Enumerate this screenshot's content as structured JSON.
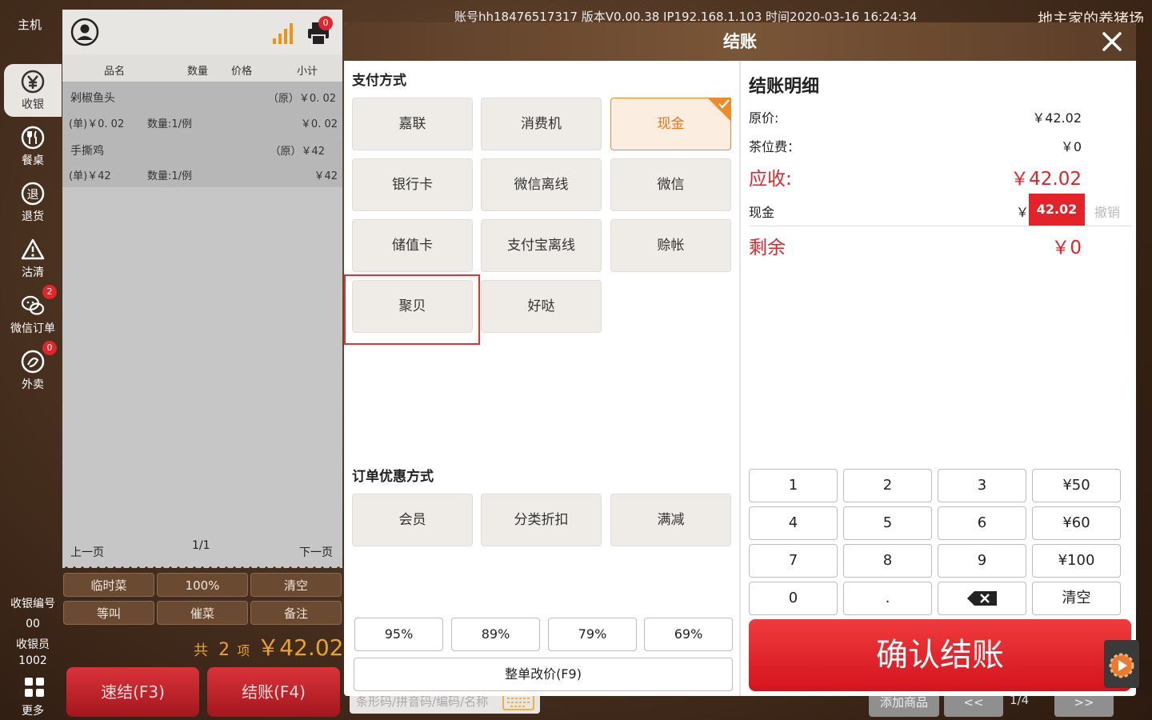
{
  "topbar": {
    "home": "主机",
    "info": "账号hh18476517317  版本V0.00.38  IP192.168.1.103  时间2020-03-16 16:24:34",
    "store": "地主家的养猪场"
  },
  "sidebar": {
    "items": [
      {
        "label": "收银",
        "icon": "yen-icon",
        "active": true
      },
      {
        "label": "餐桌",
        "icon": "cutlery-icon"
      },
      {
        "label": "退货",
        "icon": "return-icon"
      },
      {
        "label": "沽清",
        "icon": "warning-icon"
      },
      {
        "label": "微信订单",
        "icon": "wechat-icon",
        "badge": "2"
      },
      {
        "label": "外卖",
        "icon": "takeout-icon",
        "badge": "0"
      }
    ],
    "cashier_no_label": "收银编号",
    "cashier_no": "00",
    "cashier_label": "收银员",
    "cashier": "1002",
    "more": "更多"
  },
  "order": {
    "printer_badge": "0",
    "columns": [
      "品名",
      "数量",
      "价格",
      "小计"
    ],
    "items": [
      {
        "name": "剁椒鱼头",
        "orig": "（原）￥0. 02",
        "unit": "(单)￥0. 02",
        "qty": "数量:1/例",
        "subtotal": "￥0. 02"
      },
      {
        "name": "手撕鸡",
        "orig": "（原）￥42",
        "unit": "(单)￥42",
        "qty": "数量:1/例",
        "subtotal": "￥42"
      }
    ],
    "prev": "上一页",
    "page": "1/1",
    "next": "下一页",
    "buttons": [
      "临时菜",
      "100%",
      "清空",
      "等叫",
      "催菜",
      "备注"
    ],
    "total_prefix": "共",
    "total_count": "2",
    "total_unit": "项",
    "total_amount": "￥42.02",
    "quick_pay": "速结(F3)",
    "checkout": "结账(F4)"
  },
  "bottom": {
    "search_placeholder": "条形码/拼音码/编码/名称",
    "add_goods": "添加商品",
    "prev": "<<",
    "page": "1/4",
    "next": ">>"
  },
  "modal": {
    "title": "结账",
    "pay_title": "支付方式",
    "pay_methods": [
      "嘉联",
      "消费机",
      "现金",
      "银行卡",
      "微信离线",
      "微信",
      "储值卡",
      "支付宝离线",
      "赊帐",
      "聚贝",
      "好哒"
    ],
    "selected_method": "现金",
    "discount_title": "订单优惠方式",
    "discount_methods": [
      "会员",
      "分类折扣",
      "满减"
    ],
    "percent_buttons": [
      "95%",
      "89%",
      "79%",
      "69%"
    ],
    "whole_change": "整单改价(F9)",
    "detail_title": "结账明细",
    "orig_label": "原价:",
    "orig_value": "￥42.02",
    "tea_label": "茶位费：",
    "tea_value": "￥0",
    "due_label": "应收:",
    "due_value": "￥42.02",
    "cash_label": "现金",
    "cash_currency": "￥",
    "cash_value": "42.02",
    "cancel": "撤销",
    "remain_label": "剩余",
    "remain_value": "￥0",
    "keypad": [
      "1",
      "2",
      "3",
      "¥50",
      "4",
      "5",
      "6",
      "¥60",
      "7",
      "8",
      "9",
      "¥100",
      "0",
      ".",
      "⌫",
      "清空"
    ],
    "confirm": "确认结账"
  }
}
